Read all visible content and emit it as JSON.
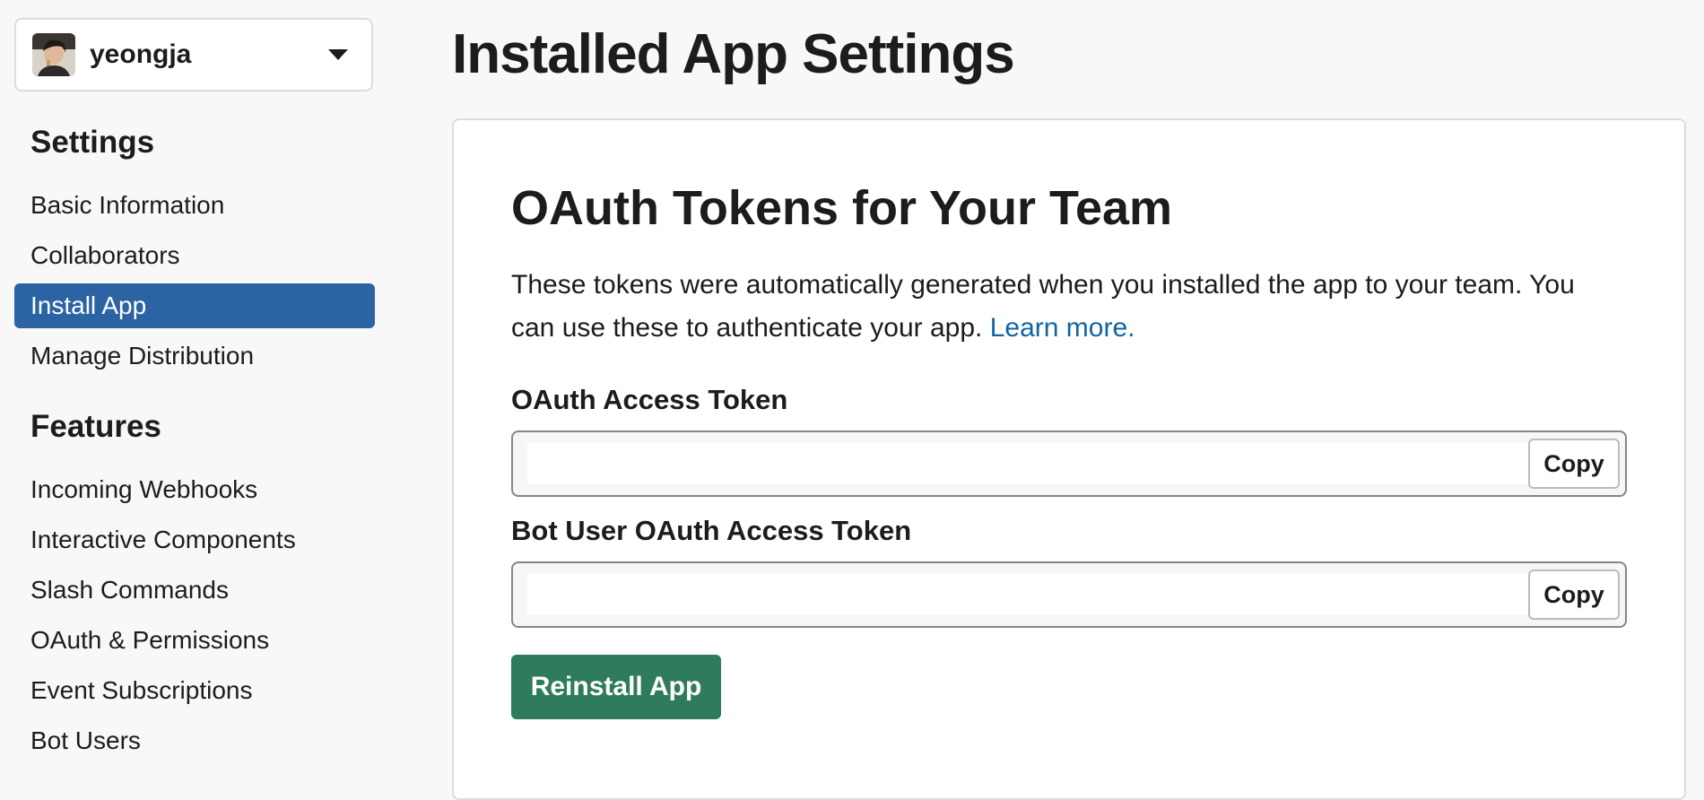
{
  "team": {
    "name": "yeongja",
    "avatar_icon": "user-avatar-photo"
  },
  "sidebar": {
    "settings_heading": "Settings",
    "settings_items": [
      {
        "label": "Basic Information",
        "active": false
      },
      {
        "label": "Collaborators",
        "active": false
      },
      {
        "label": "Install App",
        "active": true
      },
      {
        "label": "Manage Distribution",
        "active": false
      }
    ],
    "features_heading": "Features",
    "features_items": [
      {
        "label": "Incoming Webhooks"
      },
      {
        "label": "Interactive Components"
      },
      {
        "label": "Slash Commands"
      },
      {
        "label": "OAuth & Permissions"
      },
      {
        "label": "Event Subscriptions"
      },
      {
        "label": "Bot Users"
      }
    ],
    "active_color": "#2c63a2"
  },
  "main": {
    "page_title": "Installed App Settings",
    "card": {
      "title": "OAuth Tokens for Your Team",
      "description": "These tokens were automatically generated when you installed the app to your team. You can use these to authenticate your app.",
      "learn_more_label": "Learn more.",
      "link_color": "#1264a3",
      "tokens": [
        {
          "label": "OAuth Access Token",
          "value": "",
          "copy_label": "Copy"
        },
        {
          "label": "Bot User OAuth Access Token",
          "value": "",
          "copy_label": "Copy"
        }
      ],
      "reinstall_label": "Reinstall App",
      "reinstall_color": "#2f7b5e"
    }
  }
}
